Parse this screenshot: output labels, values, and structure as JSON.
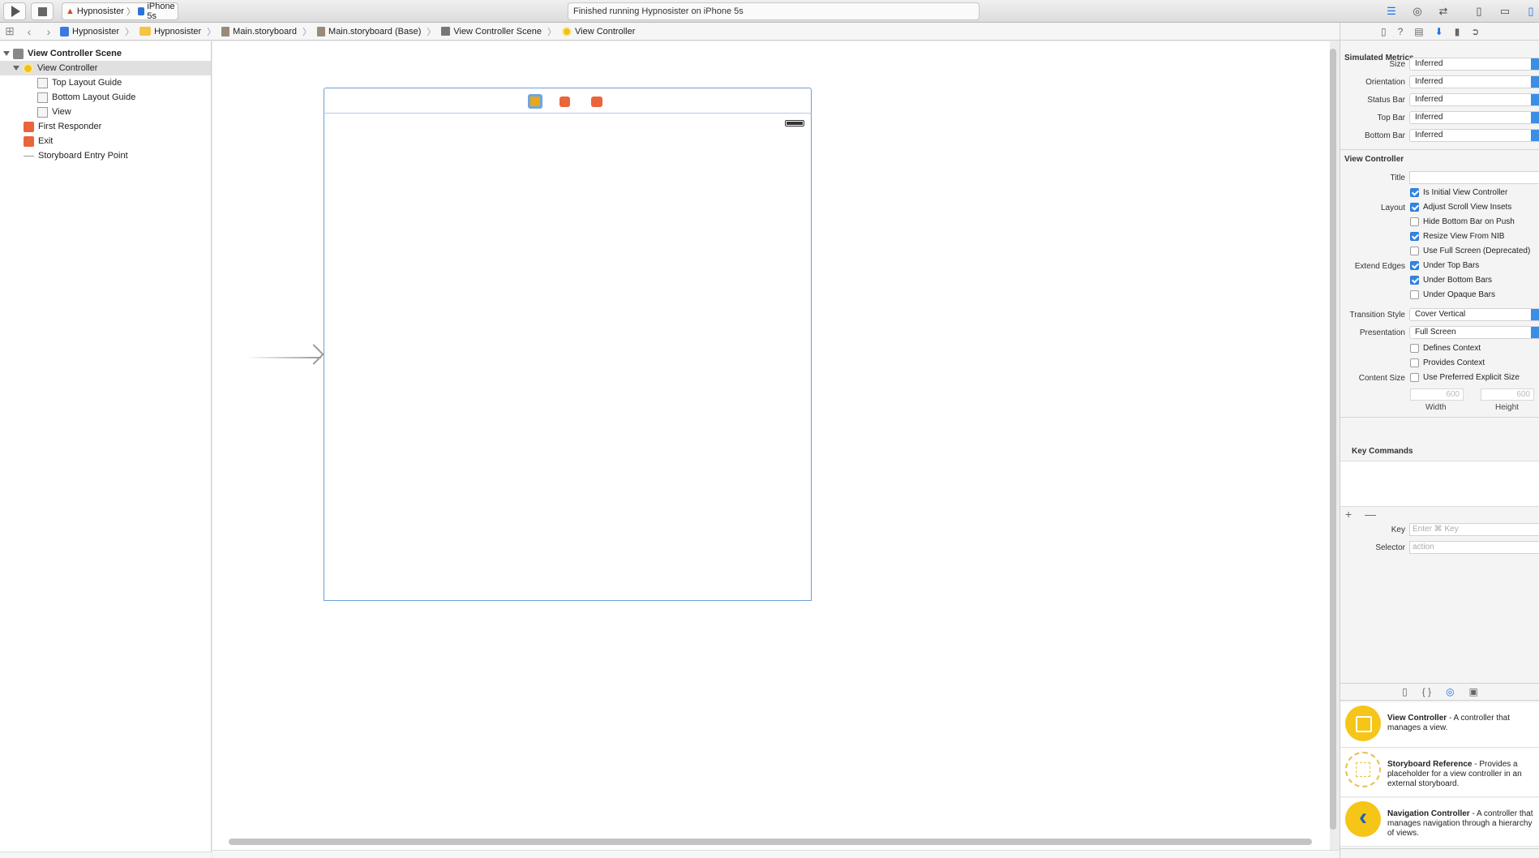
{
  "toolbar": {
    "scheme_project": "Hypnosister",
    "scheme_device": "iPhone 5s",
    "status": "Finished running Hypnosister on iPhone 5s"
  },
  "jumpbar": {
    "crumbs": [
      "Hypnosister",
      "Hypnosister",
      "Main.storyboard",
      "Main.storyboard (Base)",
      "View Controller Scene",
      "View Controller"
    ]
  },
  "outline": {
    "scene": "View Controller Scene",
    "items": [
      "View Controller",
      "Top Layout Guide",
      "Bottom Layout Guide",
      "View",
      "First Responder",
      "Exit",
      "Storyboard Entry Point"
    ]
  },
  "inspector": {
    "simulated_metrics": {
      "title": "Simulated Metrics",
      "rows": [
        {
          "label": "Size",
          "value": "Inferred"
        },
        {
          "label": "Orientation",
          "value": "Inferred"
        },
        {
          "label": "Status Bar",
          "value": "Inferred"
        },
        {
          "label": "Top Bar",
          "value": "Inferred"
        },
        {
          "label": "Bottom Bar",
          "value": "Inferred"
        }
      ]
    },
    "view_controller": {
      "title": "View Controller",
      "title_label": "Title",
      "title_value": "",
      "initial": "Is Initial View Controller",
      "layout_label": "Layout",
      "layout_options": [
        "Adjust Scroll View Insets",
        "Hide Bottom Bar on Push",
        "Resize View From NIB",
        "Use Full Screen (Deprecated)"
      ],
      "extend_label": "Extend Edges",
      "extend_options": [
        "Under Top Bars",
        "Under Bottom Bars",
        "Under Opaque Bars"
      ],
      "transition_label": "Transition Style",
      "transition_value": "Cover Vertical",
      "presentation_label": "Presentation",
      "presentation_value": "Full Screen",
      "defines_context": "Defines Context",
      "provides_context": "Provides Context",
      "content_size_label": "Content Size",
      "preferred_size": "Use Preferred Explicit Size",
      "width_value": "600",
      "height_value": "600",
      "width_label": "Width",
      "height_label": "Height"
    },
    "key_commands": {
      "title": "Key Commands",
      "plus_minus": "+ —",
      "key_label": "Key",
      "key_placeholder": "Enter ⌘ Key",
      "selector_label": "Selector",
      "selector_placeholder": "action"
    },
    "library": [
      {
        "name": "View Controller",
        "desc": " - A controller that manages a view."
      },
      {
        "name": "Storyboard Reference",
        "desc": " - Provides a placeholder for a view controller in an external storyboard."
      },
      {
        "name": "Navigation Controller",
        "desc": " - A controller that manages navigation through a hierarchy of views."
      }
    ]
  }
}
